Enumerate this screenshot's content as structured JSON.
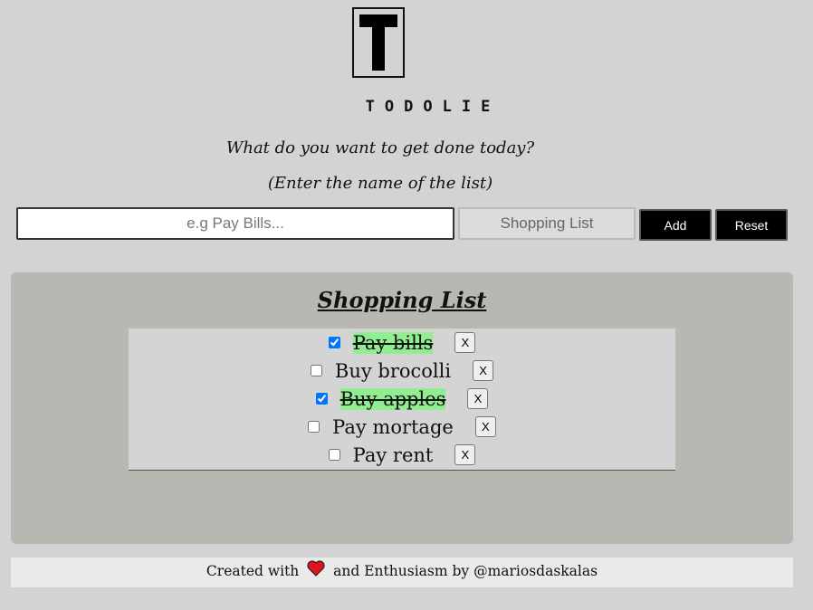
{
  "logo": {
    "letter": "T",
    "name": "TODOLIE"
  },
  "prompt": {
    "question": "What do you want to get done today?",
    "hint": "(Enter the name of the list)"
  },
  "inputs": {
    "todo_placeholder": "e.g Pay Bills...",
    "list_name_placeholder": "Shopping List"
  },
  "buttons": {
    "add": "Add",
    "reset": "Reset"
  },
  "list": {
    "title": "Shopping List",
    "items": [
      {
        "text": "Pay bills",
        "done": true,
        "delete_label": "X"
      },
      {
        "text": "Buy brocolli",
        "done": false,
        "delete_label": "X"
      },
      {
        "text": "Buy apples",
        "done": true,
        "delete_label": "X"
      },
      {
        "text": "Pay mortage",
        "done": false,
        "delete_label": "X"
      },
      {
        "text": "Pay rent",
        "done": false,
        "delete_label": "X"
      }
    ]
  },
  "footer": {
    "prefix": "Created with",
    "icon": "heart-icon",
    "suffix": "and Enthusiasm by @mariosdaskalas"
  },
  "colors": {
    "background": "#d3d3d3",
    "panel": "#b8b7b2",
    "done_highlight": "#90ee90",
    "heart": "#e0141e"
  }
}
